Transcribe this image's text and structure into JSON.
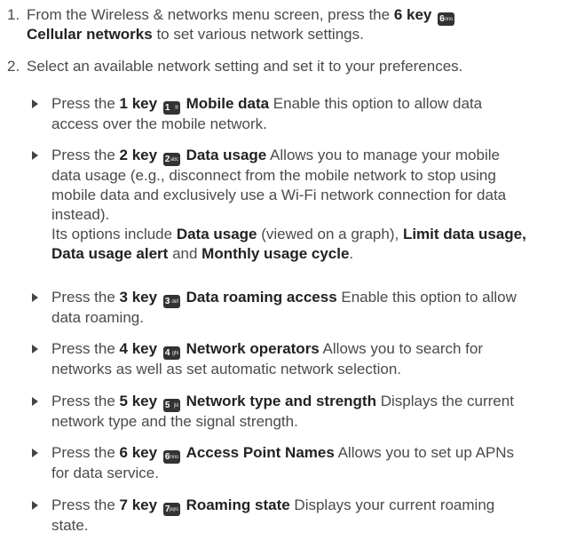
{
  "steps": [
    {
      "num": "1.",
      "line1_a": "From the Wireless & networks menu screen, press the ",
      "line1_key": "6 key",
      "line2_b": "Cellular networks",
      "line2_c": " to set various network settings."
    },
    {
      "num": "2.",
      "text": "Select an available network setting and set it to your preferences."
    }
  ],
  "keys": {
    "k6": {
      "digit": "6",
      "sub": "mno"
    },
    "k1": {
      "digit": "1",
      "sub": "®"
    },
    "k2": {
      "digit": "2",
      "sub": "abc"
    },
    "k3": {
      "digit": "3",
      "sub": "def"
    },
    "k4": {
      "digit": "4",
      "sub": "ghi"
    },
    "k5": {
      "digit": "5",
      "sub": "jkl"
    },
    "k7": {
      "digit": "7",
      "sub": "pqrs"
    }
  },
  "bullets": {
    "b1": {
      "press": "Press the ",
      "key": "1 key",
      "title": "Mobile data",
      "desc1": " Enable this option to allow data",
      "desc2": "access over the mobile network."
    },
    "b2": {
      "press": "Press the ",
      "key": "2 key",
      "title": "Data usage",
      "desc1": " Allows you to manage your mobile",
      "l2": "data usage (e.g., disconnect from the mobile network to stop using",
      "l3": "mobile data and exclusively use a Wi-Fi network connection for data",
      "l4": "instead).",
      "l5a": "Its options include ",
      "l5b": "Data usage",
      "l5c": " (viewed on a graph), ",
      "l5d": "Limit data usage,",
      "l6a": "Data usage alert",
      "l6b": " and ",
      "l6c": "Monthly usage cycle",
      "l6d": "."
    },
    "b3": {
      "press": "Press the ",
      "key": "3 key",
      "title": "Data roaming access",
      "desc1": " Enable this option to allow",
      "desc2": "data roaming."
    },
    "b4": {
      "press": "Press the ",
      "key": "4 key",
      "title": "Network operators",
      "desc1": " Allows you to search for",
      "desc2": "networks as well as set automatic network selection."
    },
    "b5": {
      "press": "Press the ",
      "key": "5 key",
      "title": "Network type and strength",
      "desc1": " Displays the current",
      "desc2": "network type and the signal strength."
    },
    "b6": {
      "press": "Press the ",
      "key": "6 key",
      "title": "Access Point Names",
      "desc1": " Allows you to set up APNs",
      "desc2": "for data service."
    },
    "b7": {
      "press": "Press the ",
      "key": "7 key",
      "title": "Roaming state",
      "desc1": " Displays your current roaming",
      "desc2": "state."
    }
  }
}
